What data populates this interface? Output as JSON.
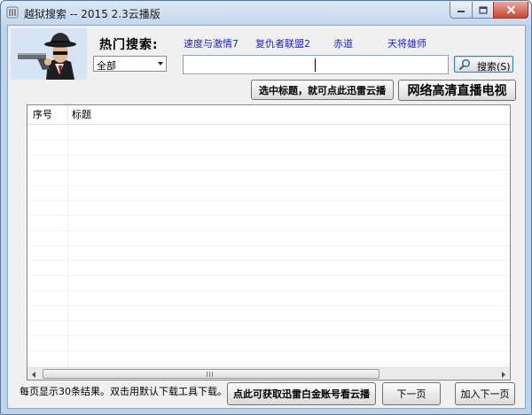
{
  "window": {
    "title": "越狱搜索 -- 2015 2.3云播版"
  },
  "hot_search": {
    "label": "热门搜索:",
    "links": [
      "速度与激情7",
      "复仇者联盟2",
      "赤道",
      "天将雄师"
    ]
  },
  "category_select": {
    "selected": "全部"
  },
  "search": {
    "value": "",
    "button_label": "搜索(S)"
  },
  "actions": {
    "select_title_button": "选中标题，就可点此迅雷云播",
    "tv_button": "网络高清直播电视"
  },
  "results_table": {
    "columns": [
      "序号",
      "标题"
    ],
    "rows": []
  },
  "footer": {
    "status_text": "每页显示30条结果。双击用默认下载工具下载。",
    "vip_button": "点此可获取迅雷白金账号看云播",
    "next_page_button": "下一页",
    "add_next_page_button": "加入下一页"
  },
  "icons": {
    "app_icon": "app-icon",
    "logo": "detective-with-gun-logo",
    "search_icon": "magnifier-icon"
  },
  "colors": {
    "window_frame": "#bcd3ea",
    "client_background": "#f0f0f0",
    "hot_link": "#1a1add",
    "close_button": "#c7462f"
  }
}
